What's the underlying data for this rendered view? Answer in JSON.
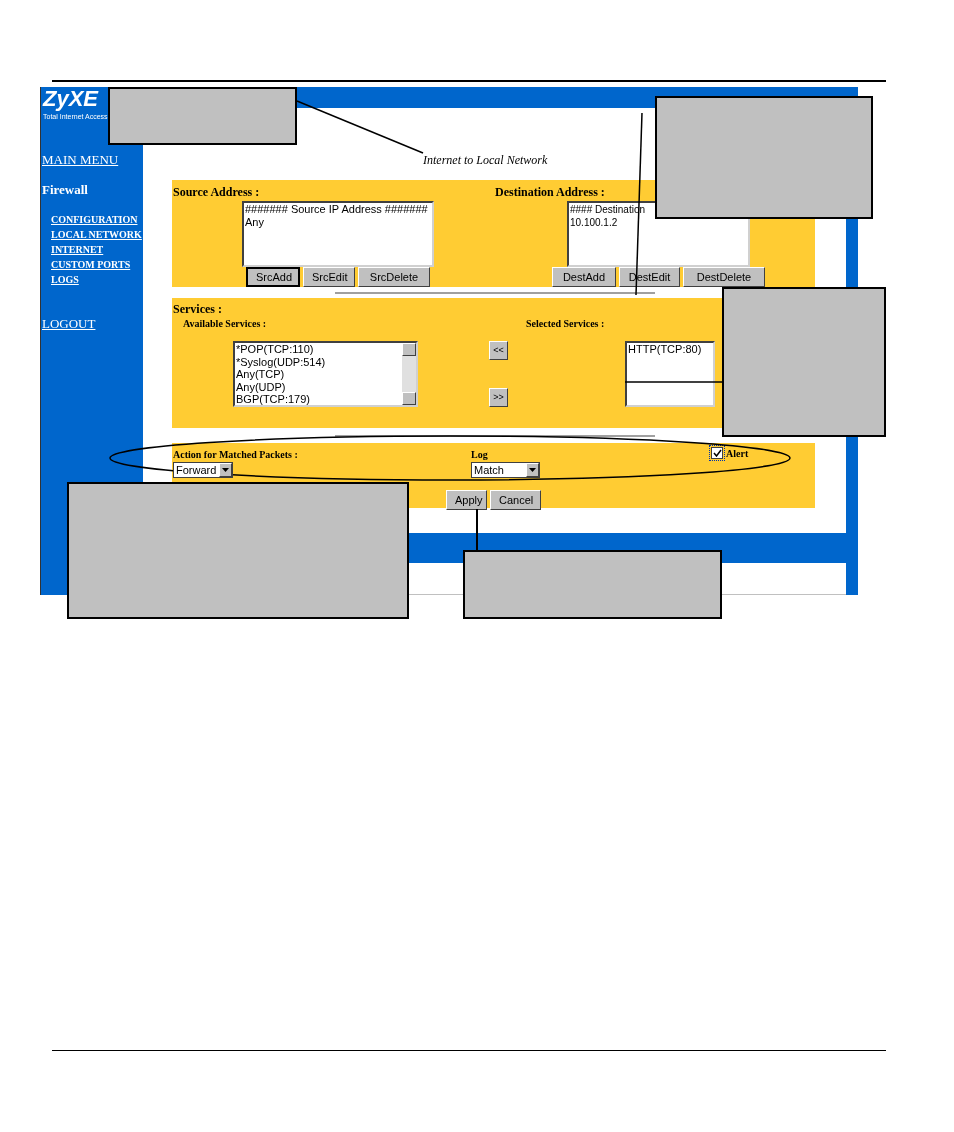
{
  "logo": {
    "name": "ZyXE",
    "tagline": "Total Internet Access"
  },
  "sidebar": {
    "main_menu": "MAIN MENU",
    "section": "Firewall",
    "items": [
      "CONFIGURATION",
      "LOCAL NETWORK",
      "INTERNET",
      "CUSTOM PORTS",
      "LOGS"
    ],
    "logout": "LOGOUT"
  },
  "subtitle": "Internet to Local Network",
  "source": {
    "label": "Source Address :",
    "entries": [
      "####### Source IP Address #######",
      "Any"
    ],
    "buttons": [
      {
        "label": "SrcAdd",
        "focused": true
      },
      {
        "label": "SrcEdit",
        "focused": false
      },
      {
        "label": "SrcDelete",
        "focused": false
      }
    ]
  },
  "destination": {
    "label": "Destination Address :",
    "entries": [
      "#### Destination",
      "10.100.1.2"
    ],
    "buttons": [
      {
        "label": "DestAdd",
        "focused": false
      },
      {
        "label": "DestEdit",
        "focused": false
      },
      {
        "label": "DestDelete",
        "focused": false
      }
    ]
  },
  "services": {
    "title": "Services :",
    "available_label": "Available Services :",
    "available": [
      "*POP(TCP:110)",
      "*Syslog(UDP:514)",
      "Any(TCP)",
      "Any(UDP)",
      "BGP(TCP:179)"
    ],
    "selected_label": "Selected Services :",
    "selected": [
      "HTTP(TCP:80)"
    ],
    "move_buttons": [
      "<<",
      ">>"
    ]
  },
  "action": {
    "label": "Action for Matched Packets :",
    "value": "Forward"
  },
  "log": {
    "label": "Log",
    "value": "Match"
  },
  "alert": {
    "label": "Alert",
    "checked": true
  },
  "buttons": [
    "Apply",
    "Cancel"
  ]
}
